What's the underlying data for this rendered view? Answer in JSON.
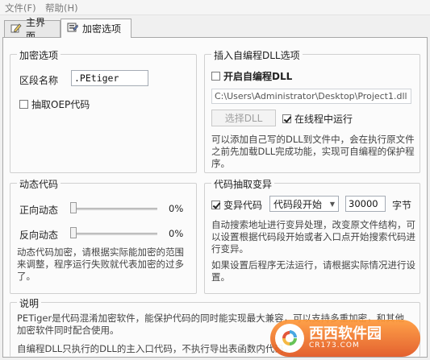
{
  "menu": {
    "file": "文件(F)",
    "help": "帮助(H)"
  },
  "tabs": [
    {
      "label": "主界面"
    },
    {
      "label": "加密选项"
    }
  ],
  "encrypt_options": {
    "title": "加密选项",
    "section_name_label": "区段名称",
    "section_name_value": ".PEtiger",
    "extract_oep_label": "抽取OEP代码",
    "extract_oep_checked": false
  },
  "dll_options": {
    "title": "插入自编程DLL选项",
    "enable_label": "开启自编程DLL",
    "enable_checked": false,
    "dll_path": "C:\\Users\\Administrator\\Desktop\\Project1.dll",
    "choose_button": "选择DLL",
    "online_label": "在线程中运行",
    "online_checked": true,
    "description": "可以添加自己写的DLL到文件中，会在执行原文件之前先加载DLL完成功能，实现可自编程的保护程序。"
  },
  "dynamic_code": {
    "title": "动态代码",
    "forward_label": "正向动态",
    "forward_value": "0%",
    "forward_fraction": 0,
    "reverse_label": "反向动态",
    "reverse_value": "0%",
    "reverse_fraction": 0,
    "description": "动态代码加密，请根据实际能加密的范围来调整，程序运行失败就代表加密的过多了。"
  },
  "code_mutation": {
    "title": "代码抽取变异",
    "mutate_label": "变异代码",
    "mutate_checked": true,
    "start_select": "代码段开始",
    "byte_count": "30000",
    "unit": "字节",
    "description1": "自动搜索地址进行变异处理，改变原文件结构，可以设置根据代码段开始或者入口点开始搜索代码进行变异。",
    "description2": "如果设置后程序无法运行，请根据实际情况进行设置。"
  },
  "notes": {
    "title": "说明",
    "line1": "PETiger是代码混淆加密软件，能保护代码的同时能实现最大兼容，可以支持多重加密，和其他加密软件同时配合使用。",
    "line2": "自编程DLL只执行的DLL的主入口代码，不执行导出表函数内代码。"
  },
  "watermark": {
    "text": "西西软件园",
    "sub": "CR173.COM"
  },
  "colors": {
    "accent_check": "#222222",
    "watermark_orange": "#e8682a"
  }
}
